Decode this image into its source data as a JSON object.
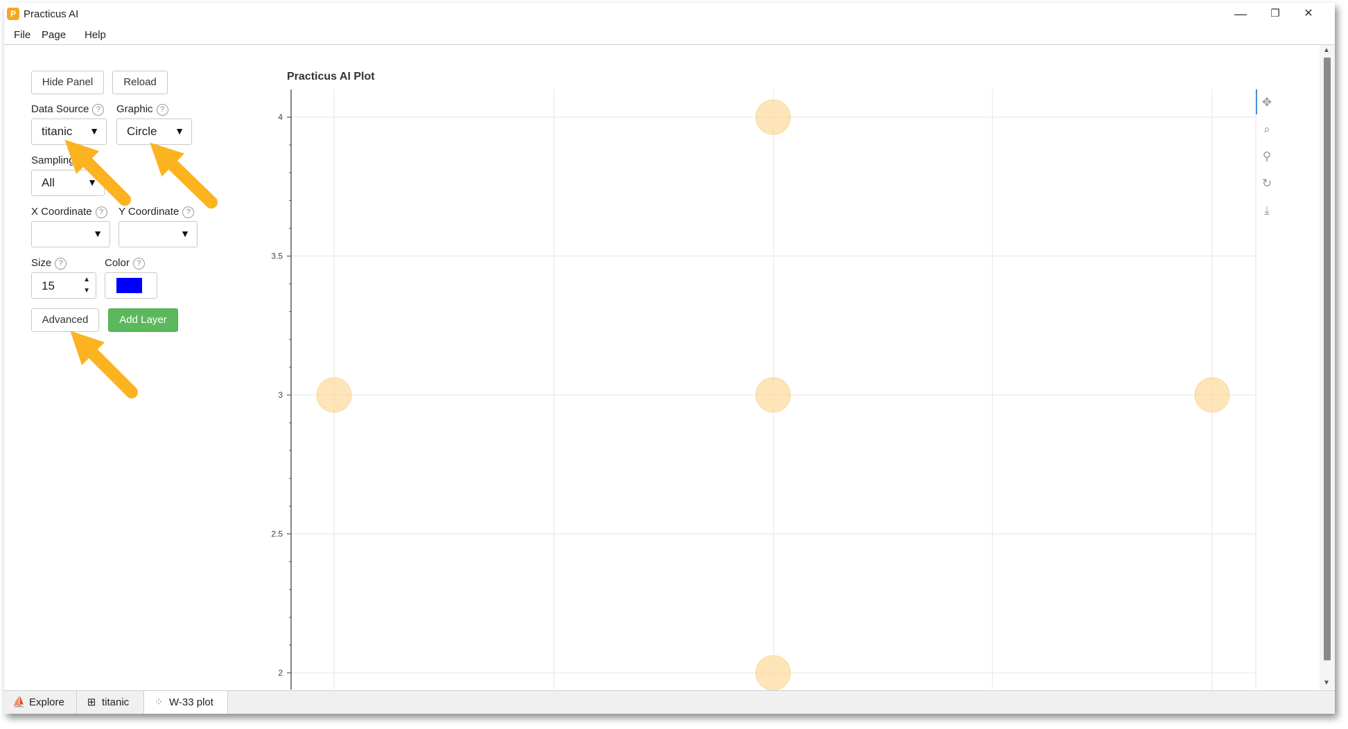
{
  "window": {
    "title": "Practicus AI",
    "minimize": "—",
    "restore": "❐",
    "close": "✕"
  },
  "menu": [
    {
      "label": "File"
    },
    {
      "label": "Page"
    },
    {
      "label": "Help"
    }
  ],
  "panel": {
    "hide_panel": "Hide Panel",
    "reload": "Reload",
    "data_source": {
      "label": "Data Source",
      "value": "titanic"
    },
    "graphic": {
      "label": "Graphic",
      "value": "Circle"
    },
    "sampling": {
      "label": "Sampling",
      "value": "All"
    },
    "x_coord": {
      "label": "X Coordinate",
      "value": ""
    },
    "y_coord": {
      "label": "Y Coordinate",
      "value": ""
    },
    "size": {
      "label": "Size",
      "value": "15"
    },
    "color": {
      "label": "Color",
      "value": "#0000ff"
    },
    "advanced": "Advanced",
    "add_layer": "Add Layer",
    "help_glyph": "?"
  },
  "chart_data": {
    "type": "scatter",
    "title": "Practicus AI Plot",
    "ylim": [
      1.94,
      4.1
    ],
    "xlim": [
      0,
      1
    ],
    "y_ticks": [
      "4",
      "3.5",
      "3",
      "2.5",
      "2"
    ],
    "points": [
      {
        "x": 0.5,
        "y": 4
      },
      {
        "x": 0.0,
        "y": 3
      },
      {
        "x": 0.5,
        "y": 3
      },
      {
        "x": 1.0,
        "y": 3
      },
      {
        "x": 0.5,
        "y": 2
      }
    ],
    "marker_color": "#fdd794",
    "grid": true
  },
  "plot_tools": [
    {
      "name": "pan-icon",
      "glyph": "✥"
    },
    {
      "name": "box-zoom-icon",
      "glyph": "⌕"
    },
    {
      "name": "wheel-zoom-icon",
      "glyph": "⚲"
    },
    {
      "name": "reset-icon",
      "glyph": "↻"
    },
    {
      "name": "save-icon",
      "glyph": "⤓"
    }
  ],
  "tabs": [
    {
      "label": "Explore",
      "icon": "⛵"
    },
    {
      "label": "titanic",
      "icon": "⊞"
    },
    {
      "label": "W-33 plot",
      "icon": "⁘"
    }
  ],
  "scroll": {
    "up": "▲",
    "down": "▼"
  }
}
